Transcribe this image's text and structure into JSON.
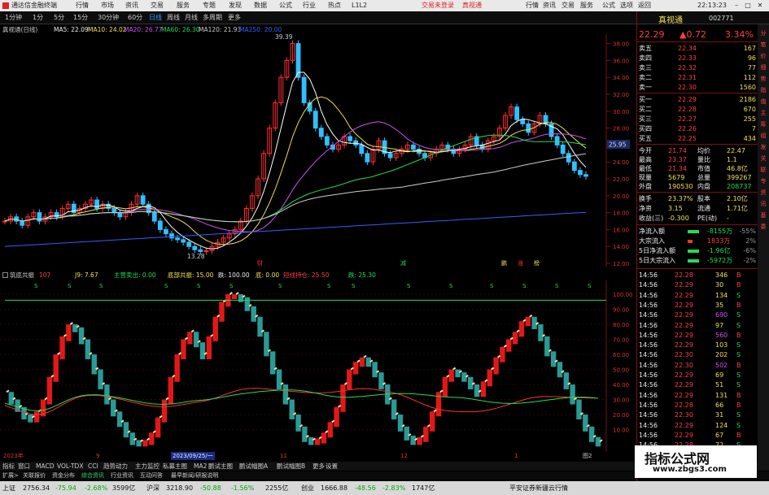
{
  "app": {
    "title": "通达信金融终端",
    "menus": [
      "行情",
      "市场",
      "资讯",
      "交易",
      "服务",
      "专题",
      "发现",
      "数据",
      "公式",
      "行业",
      "热点",
      "L1L2"
    ],
    "trade_links": [
      "交易未登录",
      "真视通"
    ],
    "right_menu": [
      "行情",
      "资讯",
      "交易",
      "服务",
      "公式",
      "选项",
      "返回"
    ],
    "clock": "22:13:23"
  },
  "toolbar": {
    "periods": [
      "1分钟",
      "1分",
      "5分",
      "15分",
      "30分钟",
      "60分",
      "日线",
      "周线",
      "月线",
      "多周期",
      "更多"
    ],
    "active": "日线"
  },
  "kline": {
    "title": "真视通(日线)",
    "ma": [
      {
        "label": "MA5: 22.09",
        "color": "#ffffff"
      },
      {
        "label": "MA10: 24.02",
        "color": "#f2e052"
      },
      {
        "label": "MA20: 26.77",
        "color": "#d050f0"
      },
      {
        "label": "MA60: 26.30",
        "color": "#22dd55"
      },
      {
        "label": "MA120: 21.93",
        "color": "#cccccc"
      },
      {
        "label": "MA250: 20.00",
        "color": "#3060ff"
      }
    ],
    "yticks": [
      "38.00",
      "36.00",
      "34.00",
      "32.00",
      "30.00",
      "28.00",
      "26.00",
      "24.00",
      "22.00",
      "20.00",
      "18.00",
      "16.00",
      "14.00",
      "12.00"
    ],
    "high_label": "39.39",
    "low_label": "13.28",
    "price_tag": "25.95",
    "markers": [
      "财",
      "减",
      "鹏",
      "涨",
      "榜"
    ]
  },
  "sub": {
    "title": "筑底共振",
    "items": [
      {
        "t": "107",
        "c": "red"
      },
      {
        "t": "J9: 7.67",
        "c": "yel"
      },
      {
        "t": "主营卖出: 0.00",
        "c": "grn"
      },
      {
        "t": "底部共振: 15.00",
        "c": "yel"
      },
      {
        "t": "跌: 100.00",
        "c": "wht"
      },
      {
        "t": "底: 0.00",
        "c": "yel"
      },
      {
        "t": "短线持仓: 25.50",
        "c": "red"
      },
      {
        "t": "跌: 25.30",
        "c": "grn"
      }
    ],
    "yticks": [
      "100.00",
      "90.00",
      "80.00",
      "70.00",
      "60.00",
      "50.00",
      "40.00",
      "30.00",
      "20.00",
      "10.00"
    ],
    "s_marks": [
      "S",
      "S",
      "S",
      "S",
      "S",
      "S",
      "S",
      "S",
      "S",
      "S",
      "S",
      "S",
      "S",
      "S",
      "S"
    ]
  },
  "dates": [
    "2023年",
    "9",
    "2023/09/25/一",
    "11",
    "12",
    "1",
    "图2"
  ],
  "tabs": [
    "指标",
    "窗口",
    "MACD",
    "VOL-TDX",
    "CCI",
    "趋势动力",
    "主力监控",
    "私募主图",
    "MA2",
    "鹏试主图",
    "鹏试幅图A",
    "鹏试幅图B",
    "更多",
    "设置"
  ],
  "tabs2": [
    "扩展>",
    "关联报价",
    "资金分布",
    "综合资讯",
    "行业资讯",
    "互动问答",
    "最早新闻/研报说明"
  ],
  "status": {
    "sh": {
      "name": "上证",
      "price": "2756.34",
      "chg": "-75.94",
      "pct": "-2.68%",
      "amt": "3599亿"
    },
    "sz": {
      "name": "沪深",
      "price": "3218.90",
      "chg": "-50.88",
      "pct": "-1.56%",
      "amt": "2255亿"
    },
    "cy": {
      "name": "创业",
      "price": "1666.88",
      "chg": "-48.56",
      "pct": "-2.83%",
      "amt": "1747亿"
    },
    "broker": "平安证券新疆云行情"
  },
  "panel": {
    "name": "真视通",
    "code": "002771",
    "price": "22.29",
    "chg": "▲0.72",
    "pct": "3.34%",
    "asks": [
      {
        "l": "卖五",
        "p": "22.34",
        "v": "167"
      },
      {
        "l": "卖四",
        "p": "22.33",
        "v": "96"
      },
      {
        "l": "卖三",
        "p": "22.32",
        "v": "77"
      },
      {
        "l": "卖二",
        "p": "22.31",
        "v": "112"
      },
      {
        "l": "卖一",
        "p": "22.30",
        "v": "1560"
      }
    ],
    "bids": [
      {
        "l": "买一",
        "p": "22.29",
        "v": "2186"
      },
      {
        "l": "买二",
        "p": "22.28",
        "v": "670"
      },
      {
        "l": "买三",
        "p": "22.27",
        "v": "255"
      },
      {
        "l": "买四",
        "p": "22.26",
        "v": "7"
      },
      {
        "l": "买五",
        "p": "22.25",
        "v": "434"
      }
    ],
    "stats": [
      [
        "今开",
        "21.74",
        "均价",
        "22.47"
      ],
      [
        "最高",
        "23.37",
        "量比",
        "1.1"
      ],
      [
        "最低",
        "21.34",
        "市值",
        "46.8亿"
      ],
      [
        "现量",
        "5679",
        "总量",
        "399267"
      ],
      [
        "外盘",
        "190530",
        "内盘",
        "208737"
      ]
    ],
    "stats2": [
      [
        "换手",
        "23.37%",
        "股本",
        "2.10亿"
      ],
      [
        "净资",
        "3.15",
        "流通",
        "1.71亿"
      ],
      [
        "收益(三)",
        "-0.300",
        "PE(动)",
        "-"
      ]
    ],
    "flow": [
      {
        "l": "净流入额",
        "v": "-8155万",
        "b": "-55%"
      },
      {
        "l": "大宗流入",
        "v": "1833万",
        "b": "2%"
      },
      {
        "l": "5日净流入额",
        "v": "-1.96亿",
        "b": "-6%"
      },
      {
        "l": "5日大宗流入",
        "v": "-5972万",
        "b": "-2%"
      }
    ],
    "ticks": [
      [
        "14:56",
        "22.28",
        "346",
        "B"
      ],
      [
        "14:56",
        "22.29",
        "30",
        "B"
      ],
      [
        "14:56",
        "22.29",
        "134",
        "S"
      ],
      [
        "14:56",
        "22.29",
        "35",
        "B"
      ],
      [
        "14:56",
        "22.29",
        "690",
        "S"
      ],
      [
        "14:56",
        "22.29",
        "97",
        "S"
      ],
      [
        "14:56",
        "22.29",
        "560",
        "B"
      ],
      [
        "14:56",
        "22.29",
        "103",
        "S"
      ],
      [
        "14:56",
        "22.30",
        "202",
        "S"
      ],
      [
        "14:56",
        "22.30",
        "502",
        "B"
      ],
      [
        "14:56",
        "22.29",
        "69",
        "S"
      ],
      [
        "14:56",
        "22.29",
        "51",
        "S"
      ],
      [
        "14:56",
        "22.29",
        "131",
        "B"
      ],
      [
        "14:56",
        "22.28",
        "66",
        "B"
      ],
      [
        "14:56",
        "22.30",
        "31",
        "S"
      ],
      [
        "14:56",
        "22.29",
        "124",
        "S"
      ],
      [
        "14:56",
        "22.29",
        "67",
        "B"
      ],
      [
        "14:56",
        "22.28",
        "72",
        "S"
      ],
      [
        "14:56",
        "22.29",
        "148",
        "S"
      ],
      [
        "14:56",
        "22.29",
        "86",
        "B"
      ]
    ]
  },
  "side_tabs": [
    "分",
    "笔",
    "价",
    "细",
    "势",
    "指",
    "值",
    "主",
    "筹",
    "组",
    "发",
    "关",
    "联",
    "专",
    "资",
    "讯",
    "基",
    "委"
  ],
  "watermark": "指标公式网",
  "watermark_url": "www.zbgs3.com"
}
